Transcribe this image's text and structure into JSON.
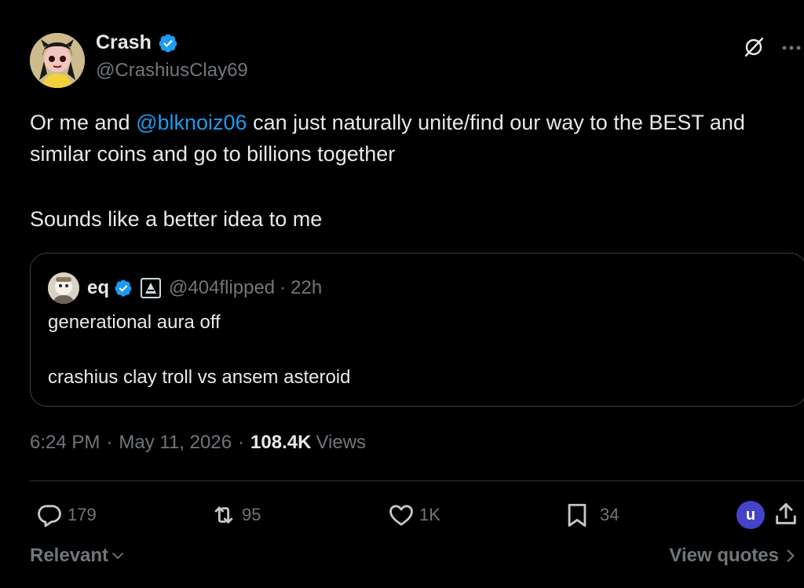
{
  "author": {
    "name": "Crash",
    "handle": "@CrashiusClay69",
    "verified": true
  },
  "tweet": {
    "text_before_mention": "Or me and ",
    "mention": "@blknoiz06",
    "text_after_mention": " can just naturally unite/find our way to the BEST and similar coins and go to billions together",
    "paragraph2": "Sounds like a better idea to me"
  },
  "quote": {
    "name": "eq",
    "handle": "@404flipped",
    "separator": "·",
    "time": "22h",
    "line1": "generational aura off",
    "line2": "crashius clay troll vs ansem asteroid"
  },
  "meta": {
    "time": "6:24 PM",
    "dot1": "·",
    "date": "May 11, 2026",
    "dot2": "·",
    "views_count": "108.4K",
    "views_label": "Views"
  },
  "actions": {
    "replies": "179",
    "reposts": "95",
    "likes": "1K",
    "bookmarks": "34"
  },
  "user_badge": "u",
  "footer": {
    "sort_label": "Relevant",
    "view_quotes": "View quotes"
  },
  "icons": {
    "verified": "verified-badge-icon",
    "grok": "grok-icon",
    "more": "more-icon",
    "reply": "reply-icon",
    "repost": "repost-icon",
    "like": "heart-icon",
    "bookmark": "bookmark-icon",
    "share": "share-icon",
    "chevron_down": "chevron-down-icon",
    "chevron_right": "chevron-right-icon"
  },
  "colors": {
    "background": "#000000",
    "text_primary": "#e7e9ea",
    "text_secondary": "#71767b",
    "accent_blue": "#1d9bf0",
    "border": "#2f3336",
    "user_badge": "#4443c9"
  }
}
